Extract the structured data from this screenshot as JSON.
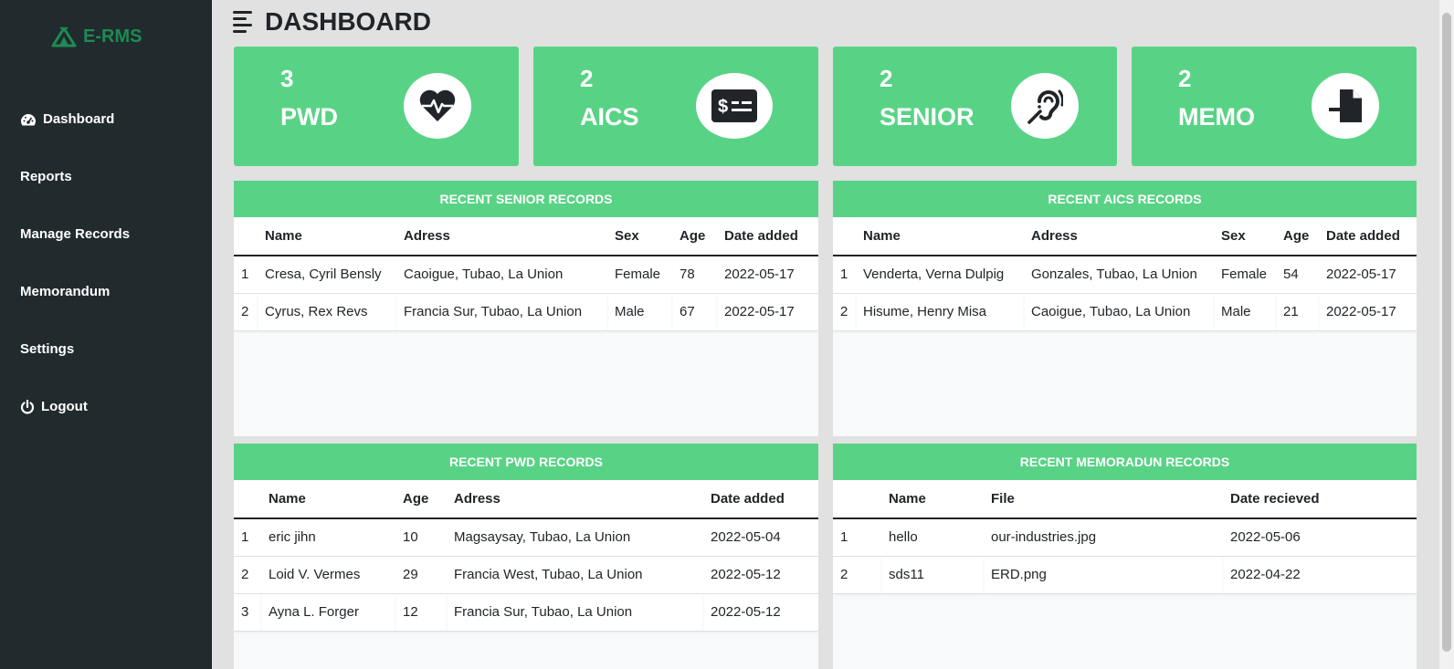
{
  "sidebar": {
    "brand": "E-RMS",
    "items": [
      {
        "label": "Dashboard"
      },
      {
        "label": "Reports"
      },
      {
        "label": "Manage Records"
      },
      {
        "label": "Memorandum"
      },
      {
        "label": "Settings"
      },
      {
        "label": "Logout"
      }
    ]
  },
  "header": {
    "title": "DASHBOARD"
  },
  "cards": [
    {
      "count": "3",
      "label": "PWD",
      "icon": "heartbeat-icon"
    },
    {
      "count": "2",
      "label": "AICS",
      "icon": "money-check-icon"
    },
    {
      "count": "2",
      "label": "SENIOR",
      "icon": "assistive-listening-icon"
    },
    {
      "count": "2",
      "label": "MEMO",
      "icon": "file-import-icon"
    }
  ],
  "senior": {
    "title": "RECENT SENIOR RECORDS",
    "headers": [
      "",
      "Name",
      "Adress",
      "Sex",
      "Age",
      "Date added"
    ],
    "rows": [
      [
        "1",
        "Cresa, Cyril Bensly",
        "Caoigue, Tubao, La Union",
        "Female",
        "78",
        "2022-05-17"
      ],
      [
        "2",
        "Cyrus, Rex Revs",
        "Francia Sur, Tubao, La Union",
        "Male",
        "67",
        "2022-05-17"
      ]
    ]
  },
  "aics": {
    "title": "RECENT AICS RECORDS",
    "headers": [
      "",
      "Name",
      "Adress",
      "Sex",
      "Age",
      "Date added"
    ],
    "rows": [
      [
        "1",
        "Venderta, Verna Dulpig",
        "Gonzales, Tubao, La Union",
        "Female",
        "54",
        "2022-05-17"
      ],
      [
        "2",
        "Hisume, Henry Misa",
        "Caoigue, Tubao, La Union",
        "Male",
        "21",
        "2022-05-17"
      ]
    ]
  },
  "pwd": {
    "title": "RECENT PWD RECORDS",
    "headers": [
      "",
      "Name",
      "Age",
      "Adress",
      "Date added"
    ],
    "rows": [
      [
        "1",
        "eric jihn",
        "10",
        "Magsaysay, Tubao, La Union",
        "2022-05-04"
      ],
      [
        "2",
        "Loid V. Vermes",
        "29",
        "Francia West, Tubao, La Union",
        "2022-05-12"
      ],
      [
        "3",
        "Ayna L. Forger",
        "12",
        "Francia Sur, Tubao, La Union",
        "2022-05-12"
      ]
    ]
  },
  "memo": {
    "title": "RECENT MEMORADUN RECORDS",
    "headers": [
      "",
      "Name",
      "File",
      "Date recieved"
    ],
    "rows": [
      [
        "1",
        "hello",
        "our-industries.jpg",
        "2022-05-06"
      ],
      [
        "2",
        "sds11",
        "ERD.png",
        "2022-04-22"
      ]
    ]
  },
  "colors": {
    "sidebar": "#212a2d",
    "accent": "#58d385",
    "brand": "#1e8a55",
    "background": "#e1e1e1"
  }
}
